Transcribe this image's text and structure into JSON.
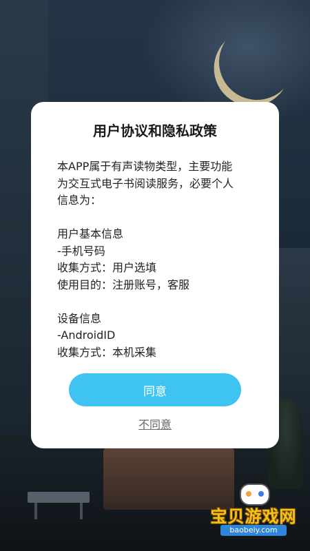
{
  "dialog": {
    "title": "用户协议和隐私政策",
    "intro_line1": "本APP属于有声读物类型，主要功能",
    "intro_line2": "为交互式电子书阅读服务，必要个人",
    "intro_line3": "信息为：",
    "section1_title": "用户基本信息",
    "section1_item": "-手机号码",
    "section1_method": "收集方式：用户选填",
    "section1_purpose": "使用目的：注册账号，客服",
    "section2_title": "设备信息",
    "section2_item": "-AndroidID",
    "section2_method": "收集方式：本机采集",
    "agree_label": "同意",
    "disagree_label": "不同意"
  },
  "watermark": {
    "brand": "宝贝游戏网",
    "url": "baobeiy.com"
  },
  "colors": {
    "accent": "#3fc3f3",
    "brand_yellow": "#f4c21b"
  }
}
